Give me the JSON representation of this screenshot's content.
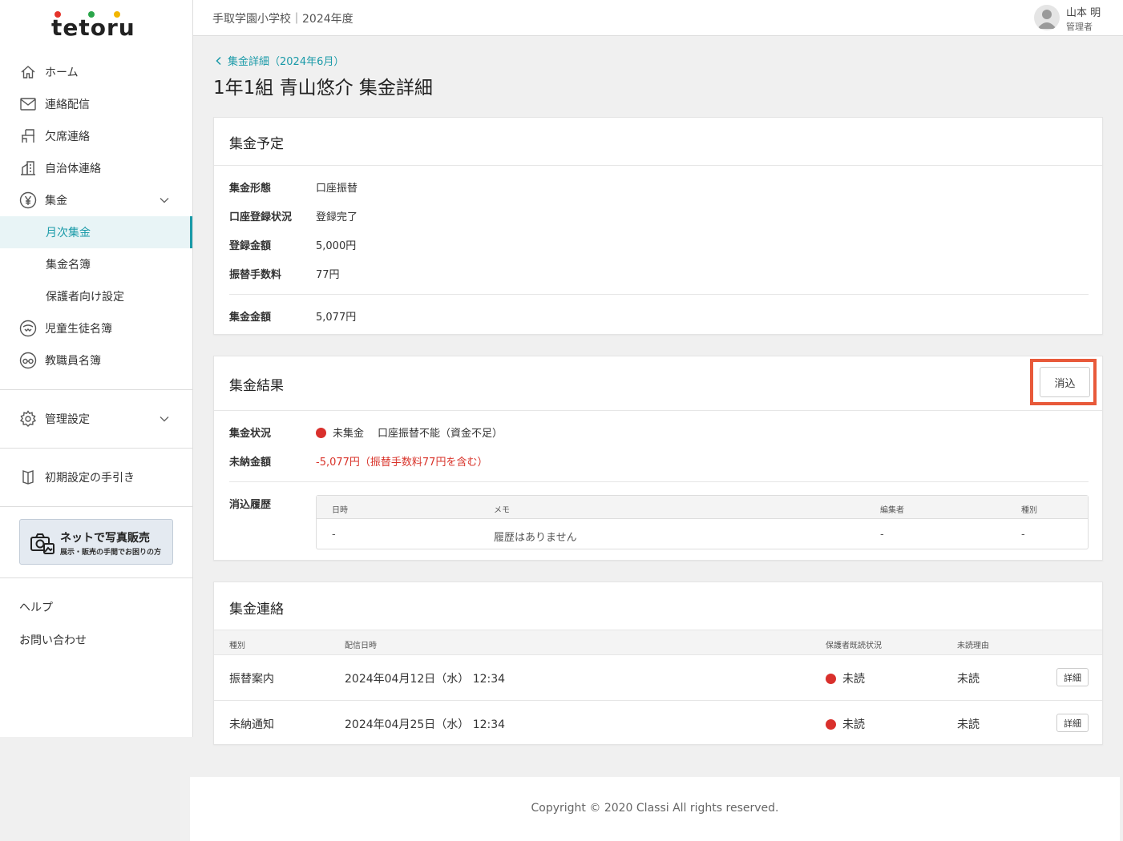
{
  "app": {
    "logo_text": "tetoru"
  },
  "header": {
    "school": "手取学園小学校｜2024年度",
    "user_name": "山本 明",
    "user_role": "管理者"
  },
  "sidebar": {
    "items": [
      {
        "label": "ホーム",
        "icon": "home-icon"
      },
      {
        "label": "連絡配信",
        "icon": "mail-icon"
      },
      {
        "label": "欠席連絡",
        "icon": "desk-icon"
      },
      {
        "label": "自治体連絡",
        "icon": "building-icon"
      },
      {
        "label": "集金",
        "icon": "yen-icon"
      },
      {
        "label": "月次集金"
      },
      {
        "label": "集金名簿"
      },
      {
        "label": "保護者向け設定"
      },
      {
        "label": "児童生徒名簿",
        "icon": "student-icon"
      },
      {
        "label": "教職員名簿",
        "icon": "teacher-icon"
      },
      {
        "label": "管理設定",
        "icon": "gear-icon"
      },
      {
        "label": "初期設定の手引き",
        "icon": "guide-icon"
      }
    ],
    "photo_banner": {
      "title": "ネットで写真販売",
      "subtitle": "展示・販売の手間でお困りの方"
    },
    "help": "ヘルプ",
    "contact": "お問い合わせ"
  },
  "page": {
    "back_link": "集金詳細（2024年6月）",
    "title": "1年1組 青山悠介 集金詳細"
  },
  "schedule": {
    "title": "集金予定",
    "rows": [
      {
        "label": "集金形態",
        "value": "口座振替"
      },
      {
        "label": "口座登録状況",
        "value": "登録完了"
      },
      {
        "label": "登録金額",
        "value": "5,000円"
      },
      {
        "label": "振替手数料",
        "value": "77円"
      }
    ],
    "total": {
      "label": "集金金額",
      "value": "5,077円"
    }
  },
  "result": {
    "title": "集金結果",
    "button": "消込",
    "status_label": "集金状況",
    "status_value": "未集金",
    "status_detail": "口座振替不能（資金不足）",
    "unpaid_label": "未納金額",
    "unpaid_value": "-5,077円（振替手数料77円を含む）",
    "history_label": "消込履歴",
    "history_headers": [
      "日時",
      "メモ",
      "編集者",
      "種別"
    ],
    "history_row": [
      "-",
      "履歴はありません",
      "-",
      "-"
    ],
    "status_color": "#d9302c"
  },
  "notice": {
    "title": "集金連絡",
    "headers": [
      "種別",
      "配信日時",
      "保護者既読状況",
      "未読理由"
    ],
    "rows": [
      {
        "type": "振替案内",
        "date": "2024年04月12日（水） 12:34",
        "read": "未読",
        "reason": "未読",
        "button": "詳細"
      },
      {
        "type": "未納通知",
        "date": "2024年04月25日（水） 12:34",
        "read": "未読",
        "reason": "未読",
        "button": "詳細"
      }
    ]
  },
  "footer": {
    "copyright": "Copyright © 2020 Classi All rights reserved."
  },
  "colors": {
    "accent": "#1a9aa8",
    "danger": "#d9302c",
    "highlight": "#e8593a"
  }
}
